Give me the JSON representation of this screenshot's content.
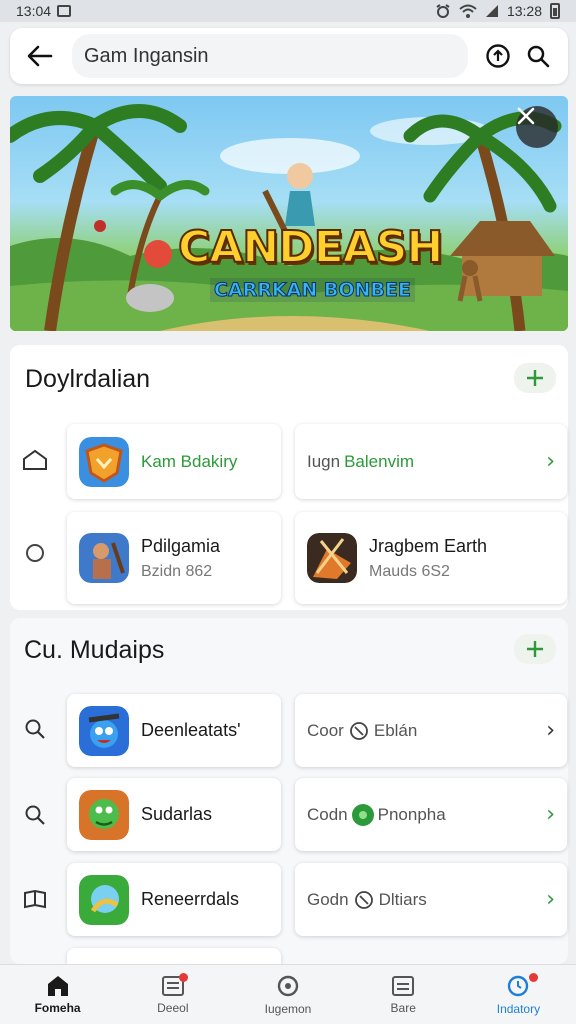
{
  "status": {
    "time_left": "13:04",
    "time_right": "13:28"
  },
  "search": {
    "value": "Gam Ingansin"
  },
  "banner": {
    "title": "CANDEASH",
    "subtitle": "CARRKAN BONBEE"
  },
  "section1": {
    "title": "Doylrdalian",
    "rows": [
      {
        "left": {
          "name": "Kam Bdakiry"
        },
        "right": {
          "prefix": "Iugn",
          "highlight": "Balenvim"
        }
      },
      {
        "left": {
          "name": "Pdilgamia",
          "sub": "Bzidn 862"
        },
        "right": {
          "name": "Jragbem Earth",
          "sub": "Mauds 6S2"
        }
      }
    ]
  },
  "section2": {
    "title": "Cu. Mudaips",
    "rows": [
      {
        "left": {
          "name": "Deenleatats'"
        },
        "right": {
          "prefix": "Coor",
          "suffix": "Eblán"
        }
      },
      {
        "left": {
          "name": "Sudarlas"
        },
        "right": {
          "prefix": "Codn",
          "suffix": "Pnonpha"
        }
      },
      {
        "left": {
          "name": "Reneerrdals"
        },
        "right": {
          "prefix": "Godn",
          "suffix": "Dltiars"
        }
      }
    ]
  },
  "nav": [
    {
      "label": "Fomeha",
      "icon": "home-icon"
    },
    {
      "label": "Deeol",
      "icon": "news-icon"
    },
    {
      "label": "Iugemon",
      "icon": "refresh-icon"
    },
    {
      "label": "Bare",
      "icon": "list-icon"
    },
    {
      "label": "Indatory",
      "icon": "clock-icon"
    }
  ],
  "colors": {
    "accent_green": "#2c9a3a",
    "accent_blue": "#1e7fd8",
    "badge_red": "#e53935"
  }
}
